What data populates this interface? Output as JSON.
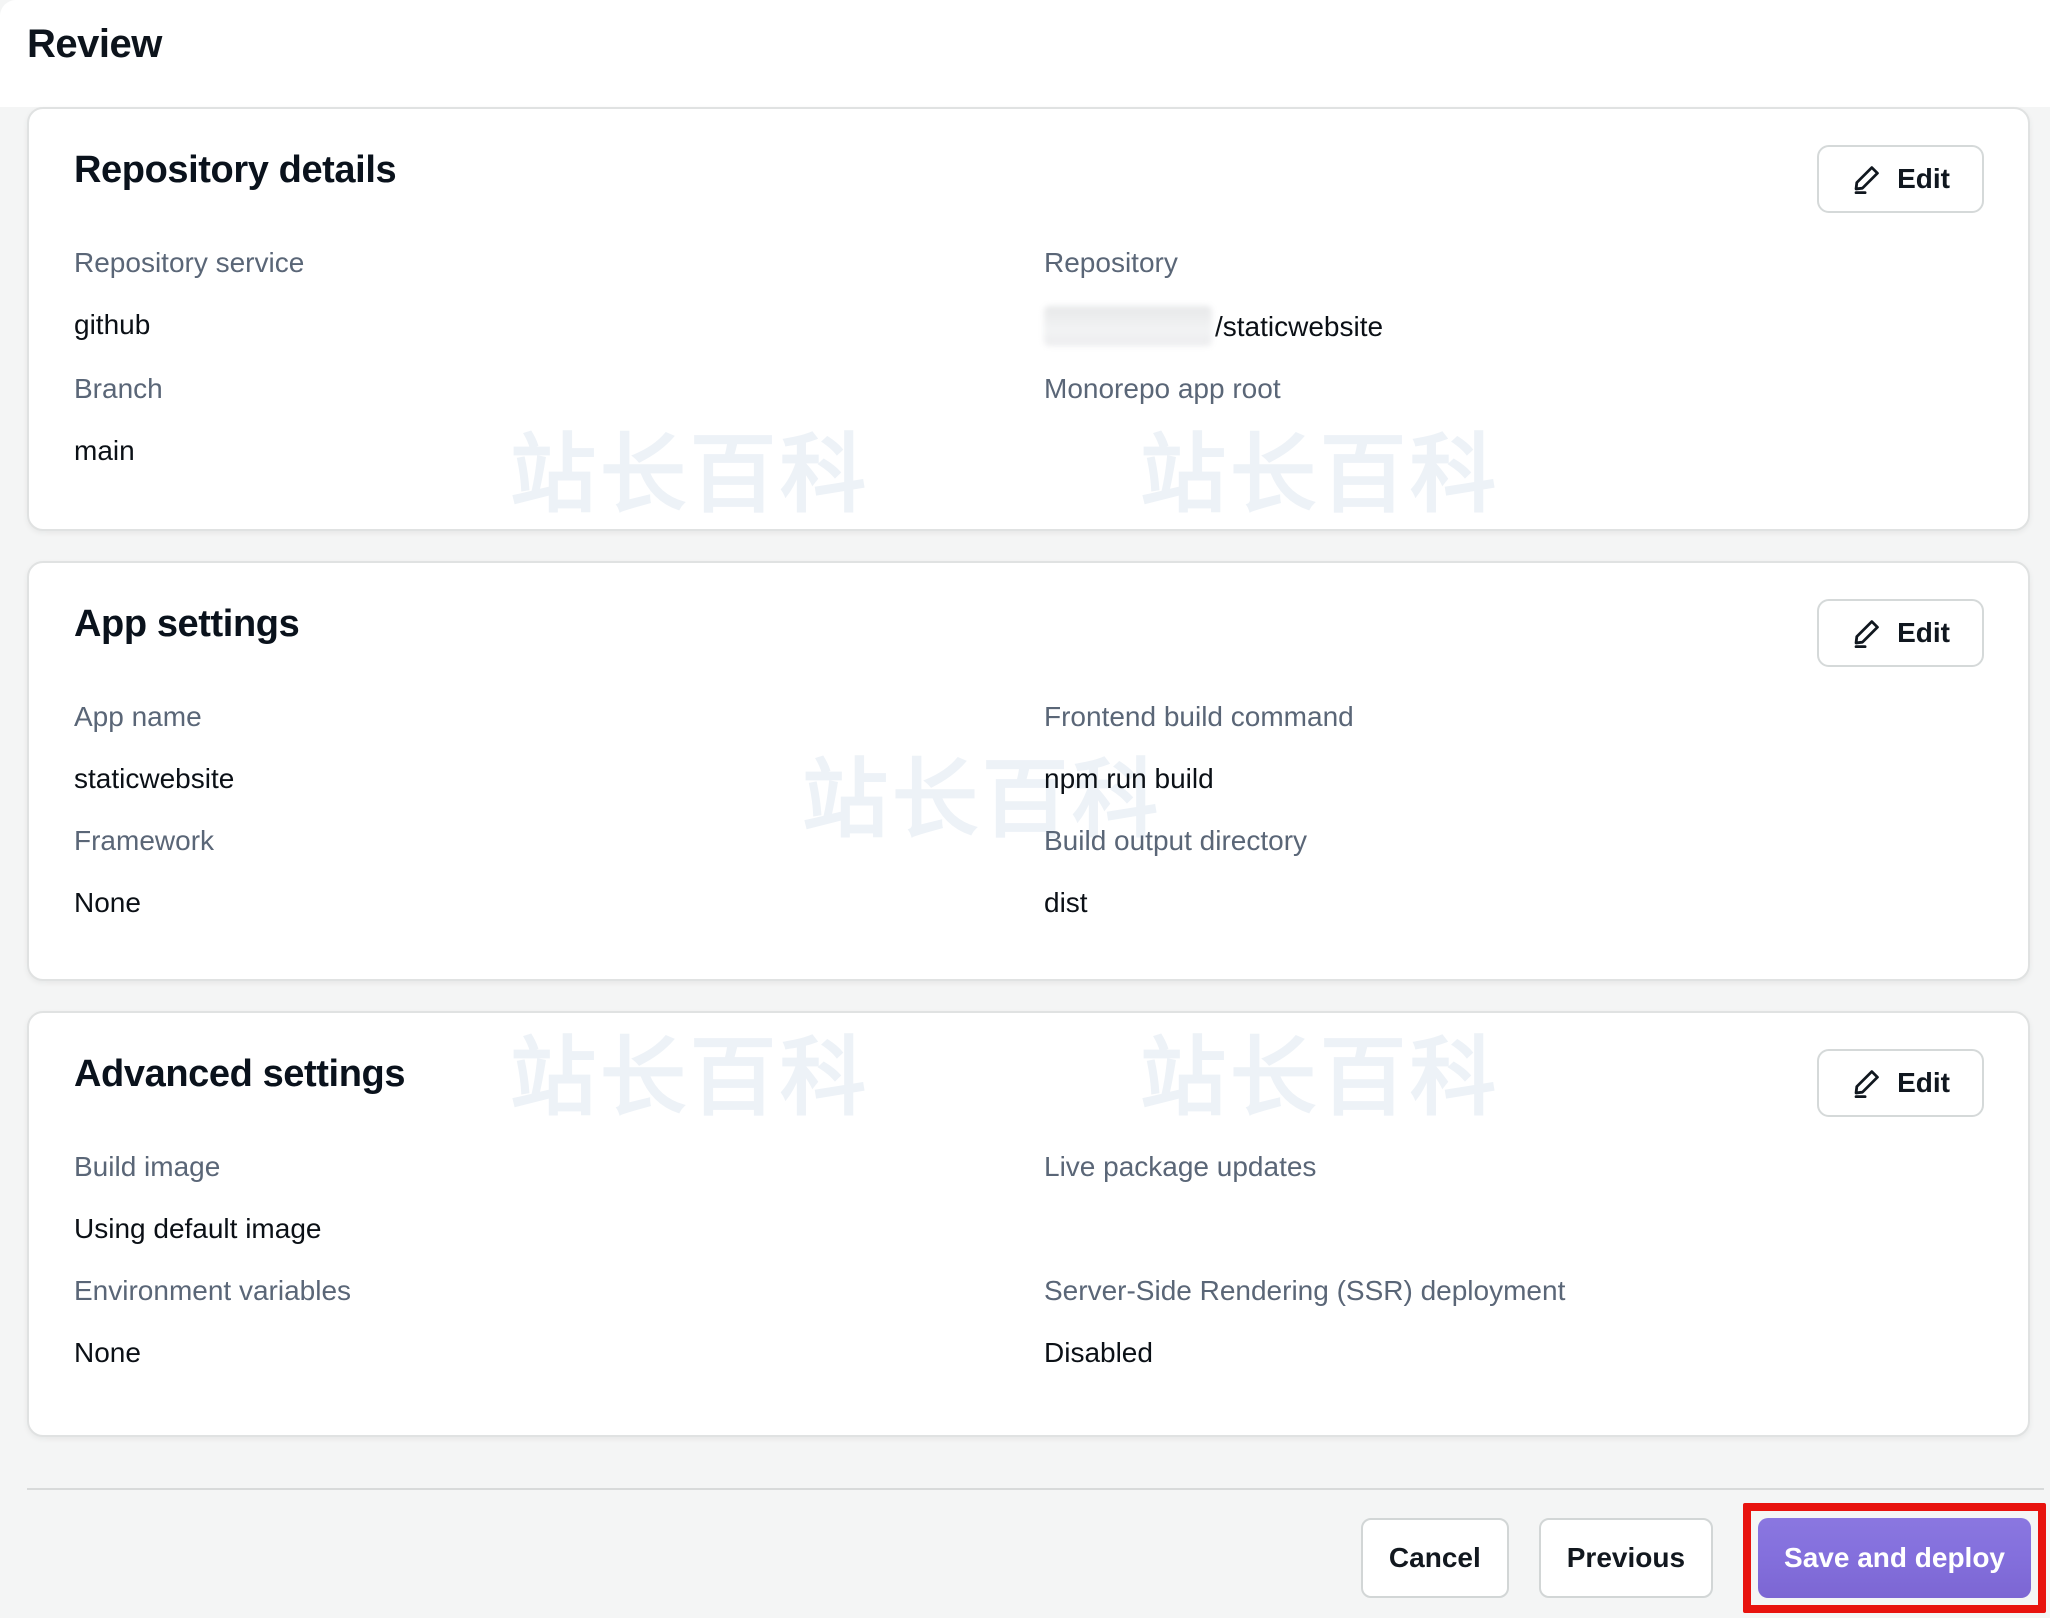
{
  "page": {
    "title": "Review"
  },
  "cards": [
    {
      "id": "repository-details",
      "title": "Repository details",
      "edit_label": "Edit",
      "fields": [
        {
          "label": "Repository service",
          "value": "github"
        },
        {
          "label": "Repository",
          "value": "/staticwebsite",
          "redacted_prefix": true
        },
        {
          "label": "Branch",
          "value": "main"
        },
        {
          "label": "Monorepo app root",
          "value": ""
        }
      ]
    },
    {
      "id": "app-settings",
      "title": "App settings",
      "edit_label": "Edit",
      "fields": [
        {
          "label": "App name",
          "value": "staticwebsite"
        },
        {
          "label": "Frontend build command",
          "value": "npm run build"
        },
        {
          "label": "Framework",
          "value": "None"
        },
        {
          "label": "Build output directory",
          "value": "dist"
        }
      ]
    },
    {
      "id": "advanced-settings",
      "title": "Advanced settings",
      "edit_label": "Edit",
      "fields": [
        {
          "label": "Build image",
          "value": "Using default image"
        },
        {
          "label": "Live package updates",
          "value": ""
        },
        {
          "label": "Environment variables",
          "value": "None"
        },
        {
          "label": "Server-Side Rendering (SSR) deployment",
          "value": "Disabled"
        }
      ]
    }
  ],
  "footer": {
    "cancel_label": "Cancel",
    "previous_label": "Previous",
    "save_label": "Save and deploy"
  },
  "watermark": {
    "text": "站长百科"
  },
  "icons": {
    "edit": "pencil-icon"
  },
  "colors": {
    "accent_purple": "#8470dd",
    "annotation_red": "#e8130e",
    "label_gray": "#5a6677",
    "value_dark": "#0b1016",
    "card_border": "#e0e2e2"
  }
}
